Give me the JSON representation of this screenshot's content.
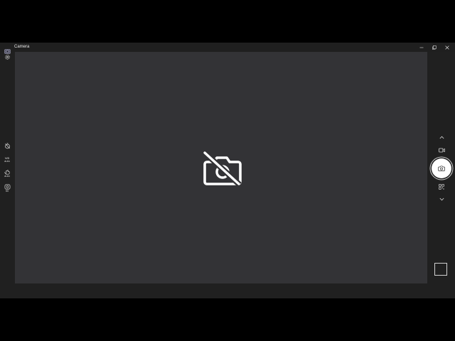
{
  "titlebar": {
    "app_name": "Camera",
    "app_icon": "camera-app-icon",
    "controls": [
      "minimize-icon",
      "maximize-icon",
      "close-icon"
    ]
  },
  "left_toolbar": {
    "settings_icon": "gear-icon",
    "timer_icon": "timer-off-icon",
    "white_balance": {
      "icon": "white-balance-icon",
      "line1": "WB",
      "line2": "auto"
    },
    "exposure": {
      "icon": "exposure-icon",
      "line1": "auto"
    },
    "iso": {
      "icon": "iso-icon",
      "line1": "50"
    }
  },
  "viewfinder": {
    "status_icon": "camera-off-icon",
    "background": "#333336"
  },
  "right_toolbar": {
    "mode_up_icon": "chevron-up-icon",
    "video_mode_icon": "video-icon",
    "photo_shutter_icon": "camera-icon",
    "barcode_mode_icon": "barcode-icon",
    "mode_down_icon": "chevron-down-icon",
    "gallery_thumbnail": "empty"
  }
}
